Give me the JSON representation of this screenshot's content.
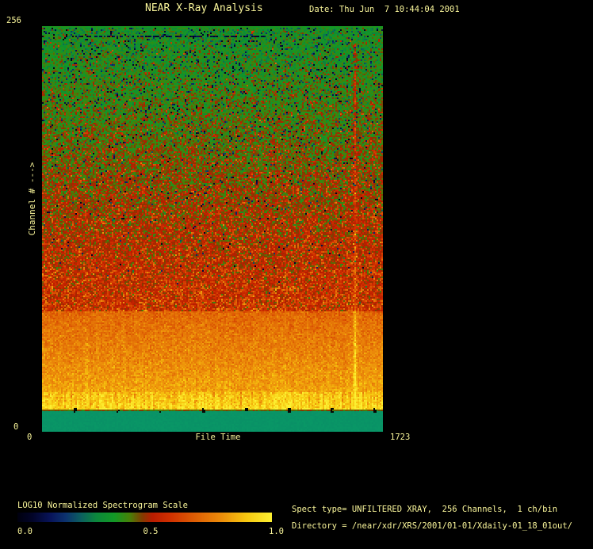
{
  "window": {
    "background": "#000000",
    "text_color": "#f9f59a"
  },
  "header": {
    "title": "NEAR X-Ray Analysis",
    "date": "Date: Thu Jun  7 10:44:04 2001"
  },
  "plot": {
    "y_axis": {
      "top_label": "256",
      "bottom_label": "0",
      "axis_label": "Channel # --->"
    },
    "x_axis": {
      "left_label": "0",
      "center_label": "File Time",
      "right_label": "1723"
    }
  },
  "colorbar": {
    "title": "LOG10 Normalized Spectrogram Scale",
    "ticks": [
      "0.0",
      "0.5",
      "1.0"
    ]
  },
  "info": {
    "spect_type": "Spect type= UNFILTERED XRAY,  256 Channels,  1 ch/bin",
    "directory": "Directory = /near/xdr/XRS/2001/01-01/Xdaily-01_18_01out/"
  },
  "chart_data": {
    "type": "heatmap",
    "title": "NEAR X-Ray Analysis",
    "xlabel": "File Time",
    "xlim": [
      0,
      1723
    ],
    "ylabel": "Channel #",
    "ylim": [
      0,
      256
    ],
    "colorbar_title": "LOG10 Normalized Spectrogram Scale",
    "colorbar_ticks": [
      0.0,
      0.5,
      1.0
    ],
    "legend_position": "bottom-left",
    "grid": false,
    "colormap": [
      [
        0.0,
        [
          0,
          0,
          14
        ]
      ],
      [
        0.06,
        [
          2,
          4,
          40
        ]
      ],
      [
        0.13,
        [
          8,
          20,
          90
        ]
      ],
      [
        0.19,
        [
          12,
          50,
          110
        ]
      ],
      [
        0.25,
        [
          12,
          95,
          95
        ]
      ],
      [
        0.31,
        [
          12,
          135,
          60
        ]
      ],
      [
        0.38,
        [
          18,
          152,
          38
        ]
      ],
      [
        0.44,
        [
          70,
          130,
          8
        ]
      ],
      [
        0.49,
        [
          130,
          60,
          0
        ]
      ],
      [
        0.53,
        [
          185,
          28,
          0
        ]
      ],
      [
        0.6,
        [
          208,
          48,
          0
        ]
      ],
      [
        0.7,
        [
          222,
          95,
          4
        ]
      ],
      [
        0.8,
        [
          236,
          140,
          10
        ]
      ],
      [
        0.9,
        [
          247,
          200,
          16
        ]
      ],
      [
        1.0,
        [
          252,
          240,
          50
        ]
      ]
    ],
    "bands": [
      {
        "name": "upper-noise-green-to-red",
        "ch_top": 256,
        "ch_bot": 76,
        "v_top": 0.37,
        "v_bot": 0.565,
        "sd": 0.05,
        "dark_speckle": 0.1,
        "hot_speckle_base": 0.03,
        "hot_speckle_gain": 0.3
      },
      {
        "name": "orange-band",
        "ch_top": 76,
        "ch_bot": 25,
        "v_top": 0.72,
        "v_bot": 0.84,
        "sd": 0.035
      },
      {
        "name": "bright-yellow-band",
        "ch_top": 25,
        "ch_bot": 14,
        "v_top": 0.88,
        "v_bot": 0.94,
        "sd": 0.045,
        "col_striation": 0.05
      },
      {
        "name": "dark-olive-separator",
        "ch_top": 14,
        "ch_bot": 13,
        "v_top": 0.465,
        "v_bot": 0.465,
        "sd": 0.02
      },
      {
        "name": "bottom-solid-green-band",
        "ch_top": 13,
        "ch_bot": 0,
        "solid_color": [
          9,
          148,
          102
        ]
      }
    ],
    "features": {
      "top_edge_line": {
        "ch_top": 256,
        "ch_bot": 255,
        "value": 0.39
      },
      "dark_horizontal_segment": {
        "ch_top": 250,
        "ch_bot": 249,
        "time_from": 150,
        "time_to": 1130
      },
      "vertical_streak": {
        "time": 1579,
        "ch_top": 245,
        "ch_bot": 14,
        "boost": 0.12
      },
      "bottom_tick_dashes": {
        "channel": 13.5,
        "interval_time": 220
      }
    }
  }
}
